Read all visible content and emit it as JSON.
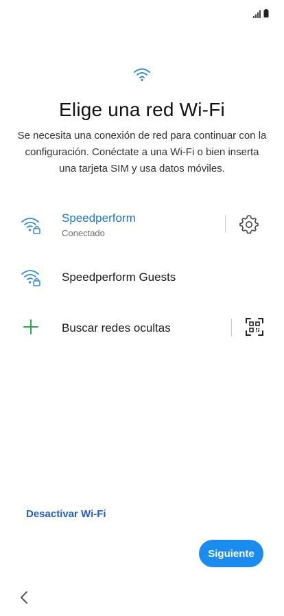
{
  "status_bar": {
    "signal_icon": "signal-bars-icon",
    "battery_icon": "battery-icon"
  },
  "header": {
    "icon": "wifi-icon",
    "title": "Elige una red Wi-Fi",
    "description": "Se necesita una conexión de red para continuar con la configuración. Conéctate a una Wi-Fi o bien inserta una tarjeta SIM y usa datos móviles."
  },
  "networks": [
    {
      "name": "Speedperform",
      "status": "Conectado",
      "icon": "wifi-lock-icon",
      "connected": true,
      "action_icon": "gear-icon"
    },
    {
      "name": "Speedperform Guests",
      "icon": "wifi-lock-icon",
      "connected": false
    }
  ],
  "hidden_networks": {
    "label": "Buscar redes ocultas",
    "icon": "plus-icon",
    "action_icon": "qr-code-icon"
  },
  "footer": {
    "disable_wifi_label": "Desactivar Wi-Fi",
    "next_label": "Siguiente",
    "back_icon": "chevron-left-icon"
  },
  "colors": {
    "accent_blue": "#1a8cf0",
    "connected_text": "#1d74c8",
    "link_blue": "#1d5fc4",
    "plus_green": "#2aa84a",
    "wifi_icon_blue": "#2f8ad8"
  }
}
